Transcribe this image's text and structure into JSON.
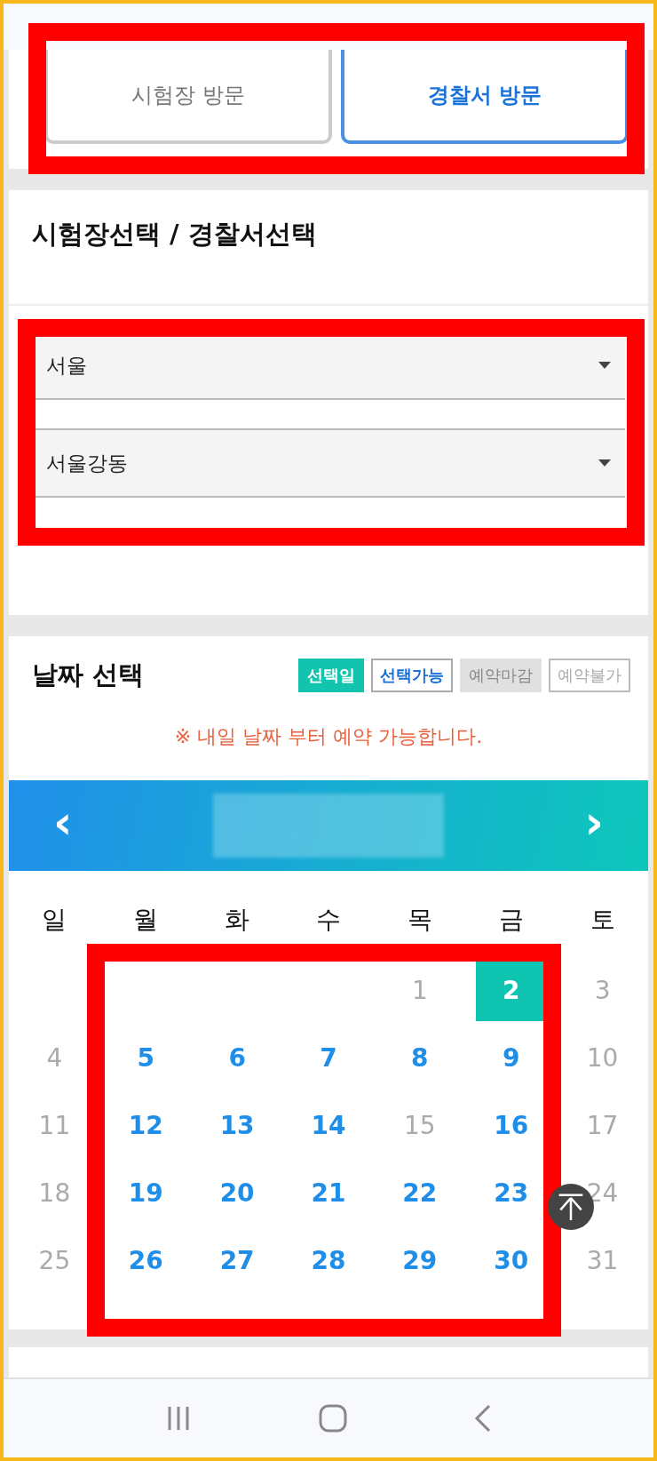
{
  "visit_tabs": [
    {
      "label": "시험장 방문",
      "selected": false
    },
    {
      "label": "경찰서 방문",
      "selected": true
    }
  ],
  "location": {
    "title": "시험장선택 / 경찰서선택",
    "selects": [
      {
        "value": "서울"
      },
      {
        "value": "서울강동"
      }
    ]
  },
  "date": {
    "title": "날짜 선택",
    "legend": [
      {
        "kind": "selected",
        "label": "선택일"
      },
      {
        "kind": "available",
        "label": "선택가능"
      },
      {
        "kind": "closed",
        "label": "예약마감"
      },
      {
        "kind": "unavailable",
        "label": "예약불가"
      }
    ],
    "notice": "※ 내일 날짜 부터 예약 가능합니다.",
    "prev": "‹",
    "next": "›",
    "weekdays": [
      "일",
      "월",
      "화",
      "수",
      "목",
      "금",
      "토"
    ],
    "weeks": [
      [
        {
          "day": "1",
          "available": false,
          "selected": false
        },
        {
          "day": "2",
          "available": true,
          "selected": true
        },
        {
          "day": "3",
          "available": false,
          "selected": false
        }
      ],
      [
        {
          "day": "4",
          "available": false,
          "selected": false
        },
        {
          "day": "5",
          "available": true,
          "selected": false
        },
        {
          "day": "6",
          "available": true,
          "selected": false
        },
        {
          "day": "7",
          "available": true,
          "selected": false
        },
        {
          "day": "8",
          "available": true,
          "selected": false
        },
        {
          "day": "9",
          "available": true,
          "selected": false
        },
        {
          "day": "10",
          "available": false,
          "selected": false
        }
      ],
      [
        {
          "day": "11",
          "available": false,
          "selected": false
        },
        {
          "day": "12",
          "available": true,
          "selected": false
        },
        {
          "day": "13",
          "available": true,
          "selected": false
        },
        {
          "day": "14",
          "available": true,
          "selected": false
        },
        {
          "day": "15",
          "available": false,
          "selected": false
        },
        {
          "day": "16",
          "available": true,
          "selected": false
        },
        {
          "day": "17",
          "available": false,
          "selected": false
        }
      ],
      [
        {
          "day": "18",
          "available": false,
          "selected": false
        },
        {
          "day": "19",
          "available": true,
          "selected": false
        },
        {
          "day": "20",
          "available": true,
          "selected": false
        },
        {
          "day": "21",
          "available": true,
          "selected": false
        },
        {
          "day": "22",
          "available": true,
          "selected": false
        },
        {
          "day": "23",
          "available": true,
          "selected": false
        },
        {
          "day": "24",
          "available": false,
          "selected": false
        }
      ],
      [
        {
          "day": "25",
          "available": false,
          "selected": false
        },
        {
          "day": "26",
          "available": true,
          "selected": false
        },
        {
          "day": "27",
          "available": true,
          "selected": false
        },
        {
          "day": "28",
          "available": true,
          "selected": false
        },
        {
          "day": "29",
          "available": true,
          "selected": false
        },
        {
          "day": "30",
          "available": true,
          "selected": false
        },
        {
          "day": "31",
          "available": false,
          "selected": false
        }
      ]
    ]
  }
}
